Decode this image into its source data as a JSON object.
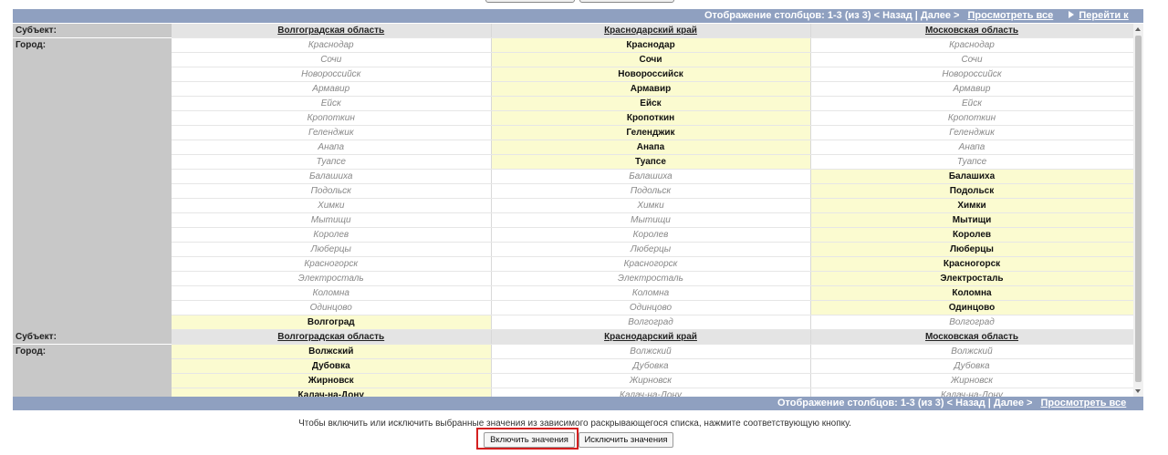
{
  "nav_top": {
    "info": "Отображение столбцов: 1-3 (из 3) < Назад | Далее >",
    "view_all": "Просмотреть все",
    "goto": "Перейти к"
  },
  "nav_bottom": {
    "info": "Отображение столбцов: 1-3 (из 3) < Назад | Далее >",
    "view_all": "Просмотреть все"
  },
  "labels": {
    "subject": "Субъект:",
    "city": "Город:"
  },
  "groups": [
    {
      "columns": [
        "Волгоградская область",
        "Краснодарский край",
        "Московская область"
      ],
      "rows": [
        {
          "cells": [
            "Краснодар",
            "Краснодар",
            "Краснодар"
          ],
          "active": 1
        },
        {
          "cells": [
            "Сочи",
            "Сочи",
            "Сочи"
          ],
          "active": 1
        },
        {
          "cells": [
            "Новороссийск",
            "Новороссийск",
            "Новороссийск"
          ],
          "active": 1
        },
        {
          "cells": [
            "Армавир",
            "Армавир",
            "Армавир"
          ],
          "active": 1
        },
        {
          "cells": [
            "Ейск",
            "Ейск",
            "Ейск"
          ],
          "active": 1
        },
        {
          "cells": [
            "Кропоткин",
            "Кропоткин",
            "Кропоткин"
          ],
          "active": 1
        },
        {
          "cells": [
            "Геленджик",
            "Геленджик",
            "Геленджик"
          ],
          "active": 1
        },
        {
          "cells": [
            "Анапа",
            "Анапа",
            "Анапа"
          ],
          "active": 1
        },
        {
          "cells": [
            "Туапсе",
            "Туапсе",
            "Туапсе"
          ],
          "active": 1
        },
        {
          "cells": [
            "Балашиха",
            "Балашиха",
            "Балашиха"
          ],
          "active": 2
        },
        {
          "cells": [
            "Подольск",
            "Подольск",
            "Подольск"
          ],
          "active": 2
        },
        {
          "cells": [
            "Химки",
            "Химки",
            "Химки"
          ],
          "active": 2
        },
        {
          "cells": [
            "Мытищи",
            "Мытищи",
            "Мытищи"
          ],
          "active": 2
        },
        {
          "cells": [
            "Королев",
            "Королев",
            "Королев"
          ],
          "active": 2
        },
        {
          "cells": [
            "Люберцы",
            "Люберцы",
            "Люберцы"
          ],
          "active": 2
        },
        {
          "cells": [
            "Красногорск",
            "Красногорск",
            "Красногорск"
          ],
          "active": 2
        },
        {
          "cells": [
            "Электросталь",
            "Электросталь",
            "Электросталь"
          ],
          "active": 2
        },
        {
          "cells": [
            "Коломна",
            "Коломна",
            "Коломна"
          ],
          "active": 2
        },
        {
          "cells": [
            "Одинцово",
            "Одинцово",
            "Одинцово"
          ],
          "active": 2
        },
        {
          "cells": [
            "Волгоград",
            "Волгоград",
            "Волгоград"
          ],
          "active": 0
        }
      ]
    },
    {
      "columns": [
        "Волгоградская область",
        "Краснодарский край",
        "Московская область"
      ],
      "rows": [
        {
          "cells": [
            "Волжский",
            "Волжский",
            "Волжский"
          ],
          "active": 0
        },
        {
          "cells": [
            "Дубовка",
            "Дубовка",
            "Дубовка"
          ],
          "active": 0
        },
        {
          "cells": [
            "Жирновск",
            "Жирновск",
            "Жирновск"
          ],
          "active": 0
        },
        {
          "cells": [
            "Калач-на-Дону",
            "Калач-на-Дону",
            "Калач-на-Дону"
          ],
          "active": 0
        }
      ]
    }
  ],
  "footer": {
    "note": "Чтобы включить или исключить выбранные значения из зависимого раскрывающегося списка, нажмите соответствующую кнопку.",
    "include": "Включить значения",
    "exclude": "Исключить значения"
  }
}
